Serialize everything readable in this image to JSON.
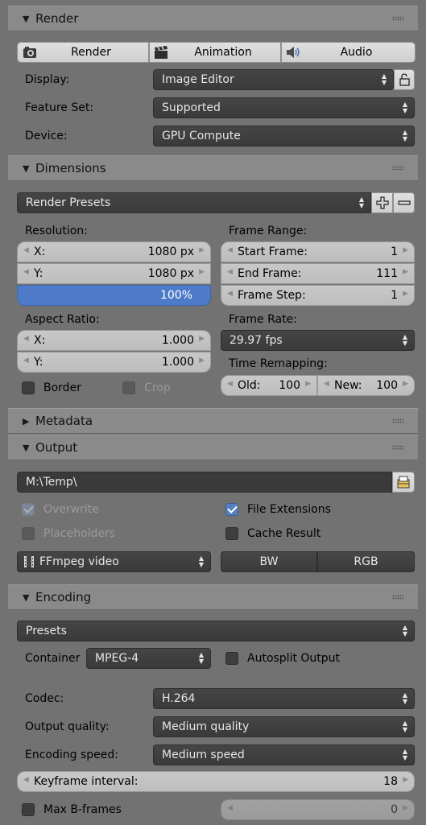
{
  "panels": {
    "render": {
      "title": "Render",
      "expanded": true
    },
    "dimensions": {
      "title": "Dimensions",
      "expanded": true
    },
    "metadata": {
      "title": "Metadata",
      "expanded": false
    },
    "output": {
      "title": "Output",
      "expanded": true
    },
    "encoding": {
      "title": "Encoding",
      "expanded": true
    }
  },
  "render": {
    "buttons": {
      "render": "Render",
      "animation": "Animation",
      "audio": "Audio"
    },
    "display": {
      "label": "Display:",
      "value": "Image Editor"
    },
    "feature_set": {
      "label": "Feature Set:",
      "value": "Supported"
    },
    "device": {
      "label": "Device:",
      "value": "GPU Compute"
    }
  },
  "dimensions": {
    "presets": "Render Presets",
    "resolution": {
      "label": "Resolution:",
      "x_key": "X:",
      "x": "1080 px",
      "y_key": "Y:",
      "y": "1080 px",
      "percent": "100%",
      "percent_value": 100
    },
    "aspect": {
      "label": "Aspect Ratio:",
      "x_key": "X:",
      "x": "1.000",
      "y_key": "Y:",
      "y": "1.000"
    },
    "border": {
      "label": "Border",
      "checked": false
    },
    "crop": {
      "label": "Crop",
      "checked": false
    },
    "frame_range": {
      "label": "Frame Range:",
      "start_key": "Start Frame:",
      "start": "1",
      "end_key": "End Frame:",
      "end": "111",
      "step_key": "Frame Step:",
      "step": "1"
    },
    "frame_rate": {
      "label": "Frame Rate:",
      "value": "29.97 fps"
    },
    "time_remap": {
      "label": "Time Remapping:",
      "old_key": "Old:",
      "old": "100",
      "new_key": "New:",
      "new": "100"
    }
  },
  "output": {
    "path": "M:\\Temp\\",
    "overwrite": {
      "label": "Overwrite",
      "checked": true,
      "enabled": false
    },
    "file_extensions": {
      "label": "File Extensions",
      "checked": true
    },
    "placeholders": {
      "label": "Placeholders",
      "checked": false,
      "enabled": false
    },
    "cache_result": {
      "label": "Cache Result",
      "checked": false
    },
    "format": "FFmpeg video",
    "color_bw": "BW",
    "color_rgb": "RGB"
  },
  "encoding": {
    "presets": "Presets",
    "container_label": "Container",
    "container": "MPEG-4",
    "autosplit": {
      "label": "Autosplit Output",
      "checked": false
    },
    "codec": {
      "label": "Codec:",
      "value": "H.264"
    },
    "quality": {
      "label": "Output quality:",
      "value": "Medium quality"
    },
    "speed": {
      "label": "Encoding speed:",
      "value": "Medium speed"
    },
    "keyframe": {
      "label": "Keyframe interval:",
      "value": "18"
    },
    "max_bframes": {
      "label": "Max B-frames",
      "checked": false,
      "value": "0"
    }
  },
  "colors": {
    "accent": "#5680c2",
    "panel_header": "#8a8a8a",
    "background": "#727272"
  }
}
